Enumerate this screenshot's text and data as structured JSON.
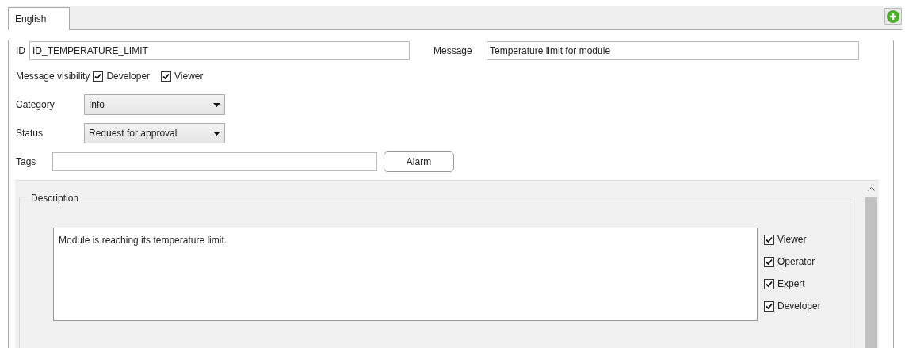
{
  "tabs": [
    {
      "label": "English",
      "selected": true
    }
  ],
  "id_field": {
    "label": "ID",
    "value": "ID_TEMPERATURE_LIMIT"
  },
  "message_field": {
    "label": "Message",
    "value": "Temperature limit for module"
  },
  "visibility": {
    "label": "Message visibility",
    "options": [
      {
        "label": "Developer",
        "checked": true
      },
      {
        "label": "Viewer",
        "checked": true
      }
    ]
  },
  "category": {
    "label": "Category",
    "value": "Info"
  },
  "status": {
    "label": "Status",
    "value": "Request for approval"
  },
  "tags": {
    "label": "Tags",
    "button": "Alarm"
  },
  "description": {
    "title": "Description",
    "text": "Module is reaching its temperature limit.",
    "roles": [
      {
        "label": "Viewer",
        "checked": true
      },
      {
        "label": "Operator",
        "checked": true
      },
      {
        "label": "Expert",
        "checked": true
      },
      {
        "label": "Developer",
        "checked": true
      }
    ]
  }
}
